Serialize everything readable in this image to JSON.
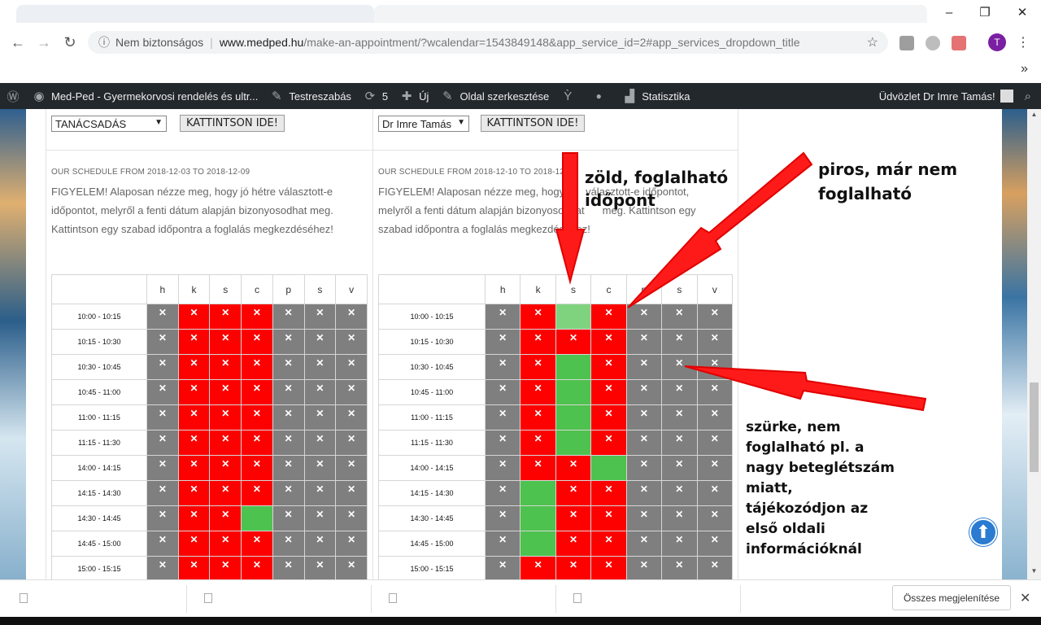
{
  "browser": {
    "security_label": "Nem biztonságos",
    "url_host": "www.medped.hu",
    "url_path": "/make-an-appointment/?wcalendar=1543849148&app_service_id=2#app_services_dropdown_title",
    "profile_initial": "T"
  },
  "adminbar": {
    "site_name": "Med-Ped - Gyermekorvosi rendelés és ultr...",
    "customize": "Testreszabás",
    "updates_count": "5",
    "new": "Új",
    "edit_page": "Oldal szerkesztése",
    "statistics": "Statisztika",
    "greeting": "Üdvözlet Dr Imre Tamás!"
  },
  "left_panel": {
    "select_value": "TANÁCSADÁS",
    "button": "KATTINTSON IDE!",
    "schedule_title": "OUR SCHEDULE FROM 2018-12-03 TO 2018-12-09",
    "notice_line1": "FIGYELEM! Alaposan nézze meg, hogy jó hétre választott-e",
    "notice_line2": "időpontot, melyről a fenti dátum alapján bizonyosodhat meg.",
    "notice_line3": "Kattintson egy szabad időpontra a foglalás megkezdéséhez!"
  },
  "right_panel": {
    "select_value": "Dr Imre Tamás",
    "button": "KATTINTSON IDE!",
    "schedule_title": "OUR SCHEDULE FROM 2018-12-10 TO 2018-12-",
    "notice_line1": "FIGYELEM! Alaposan nézze meg, hogy",
    "notice_line1b": "választott-e időpontot,",
    "notice_line2": "melyről a fenti dátum alapján bizonyosodhat",
    "notice_line2b": "meg. Kattintson egy",
    "notice_line3": "szabad időpontra a foglalás megkezdéséhez!"
  },
  "calendar": {
    "days": [
      "h",
      "k",
      "s",
      "c",
      "p",
      "s",
      "v"
    ],
    "times": [
      "10:00 - 10:15",
      "10:15 - 10:30",
      "10:30 - 10:45",
      "10:45 - 11:00",
      "11:00 - 11:15",
      "11:15 - 11:30",
      "14:00 - 14:15",
      "14:15 - 14:30",
      "14:30 - 14:45",
      "14:45 - 15:00",
      "15:00 - 15:15"
    ],
    "unavailable_mark": "✕",
    "status_colors": {
      "busy": "#fd0000",
      "free": "#4ec24e",
      "closed": "#7f7f7f"
    },
    "left_grid": [
      "grrrggg",
      "grrrggg",
      "grrrggg",
      "grrrggg",
      "grrrggg",
      "grrrggg",
      "grrrggg",
      "grrrggg",
      "grrvggg",
      "grrrggg",
      "grrrggg"
    ],
    "right_grid": [
      "grlrggg",
      "grrrggg",
      "grvrggg",
      "grvrggg",
      "grvrggg",
      "grvrggg",
      "grrvggg",
      "gvrrggg",
      "gvrrggg",
      "gvrrggg",
      "grrrggg"
    ]
  },
  "annotations": {
    "green_line1": "zöld, foglalható",
    "green_line2": "időpont",
    "red_line1": "piros, már nem",
    "red_line2": "foglalható",
    "grey_line1": "szürke, nem",
    "grey_line2": "foglalható pl.  a",
    "grey_line3": "nagy beteglétszám",
    "grey_line4": "miatt,",
    "grey_line5": "tájékozódjon az",
    "grey_line6": "első oldali",
    "grey_line7": "információknál"
  },
  "downloads": {
    "show_all": "Összes megjelenítése"
  }
}
